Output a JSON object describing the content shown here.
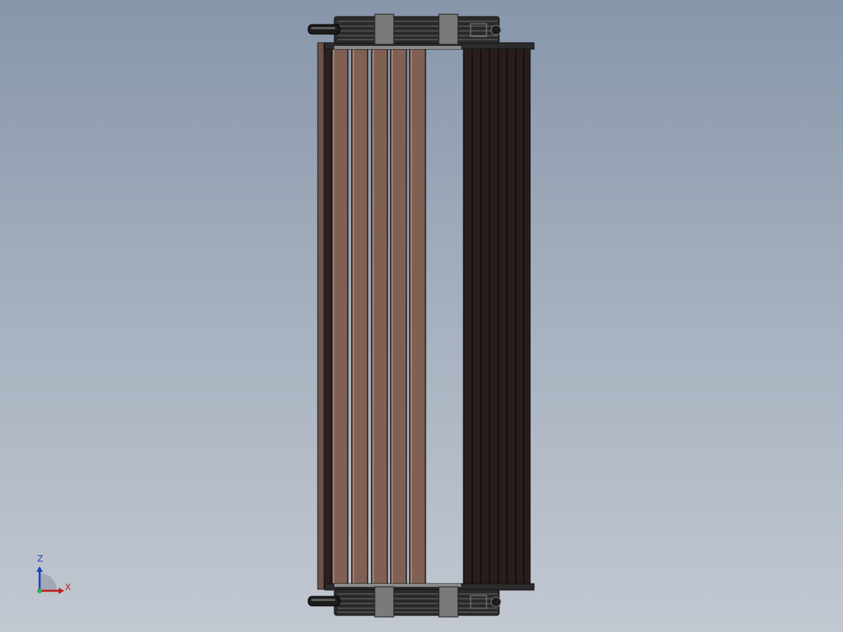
{
  "viewport": {
    "background_top": "#8796aa",
    "background_bottom": "#c2c8d1"
  },
  "model": {
    "wood_color": "#7f6052",
    "dark_slat_color": "#2a1e1c",
    "frame_color": "#2b2b2b",
    "clip_color": "#7a7a7a"
  },
  "triad": {
    "z_label": "Z",
    "x_label": "X",
    "z_color": "#1a3fbf",
    "x_color": "#c21b1b"
  }
}
